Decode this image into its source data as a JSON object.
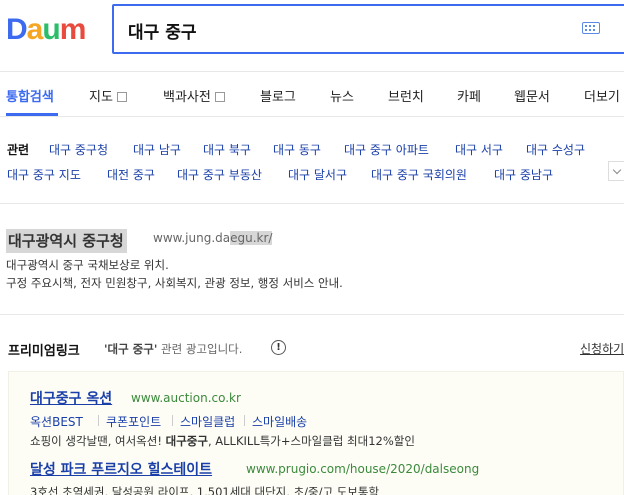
{
  "logo": {
    "letters": [
      "D",
      "a",
      "u",
      "m"
    ],
    "colors": [
      "#3d6bf0",
      "#f5a623",
      "#2bbd6a",
      "#e84a3d"
    ]
  },
  "search": {
    "value": "대구 중구",
    "accent": "#3d6bf0"
  },
  "tabs": [
    {
      "label": "통합검색",
      "active": true
    },
    {
      "label": "지도",
      "checkbox": true
    },
    {
      "label": "백과사전",
      "checkbox": true
    },
    {
      "label": "블로그"
    },
    {
      "label": "뉴스"
    },
    {
      "label": "브런치"
    },
    {
      "label": "카페"
    },
    {
      "label": "웹문서"
    },
    {
      "label": "더보기"
    }
  ],
  "related": {
    "title": "관련",
    "row1": [
      "대구 중구청",
      "대구 남구",
      "대구 북구",
      "대구 동구",
      "대구 중구 아파트",
      "대구 서구",
      "대구 수성구"
    ],
    "row2": [
      "대구 중구 지도",
      "대전 중구",
      "대구 중구 부동산",
      "대구 달서구",
      "대구 중구 국회의원",
      "대구 중남구"
    ]
  },
  "result": {
    "title": "대구광역시 중구청",
    "url_part1": "www.jung.da",
    "url_part2": "egu.kr/",
    "desc_line1": "대구광역시 중구 국채보상로 위치.",
    "desc_line2": "구정 주요시책, 전자 민원창구, 사회복지, 관광 정보, 행정 서비스 안내."
  },
  "premium": {
    "title": "프리미엄링크",
    "query": "'대구 중구'",
    "sub_suffix": " 관련 광고입니다.",
    "info_icon": "!",
    "apply_label": "신청하기",
    "ads": [
      {
        "title": "대구중구 옥션",
        "url": "www.auction.co.kr",
        "sublinks": [
          "옥션BEST",
          "쿠폰포인트",
          "스마일클럽",
          "스마일배송"
        ],
        "desc_pre": "쇼핑이 생각날땐, 여서옥션! ",
        "desc_bold": "대구중구",
        "desc_post": ", ALLKILL특가+스마일클럽 최대12%할인"
      },
      {
        "title": "달성 파크 푸르지오 힐스테이트",
        "url": "www.prugio.com/house/2020/dalseong",
        "desc": "3호선 초역세권, 달성공원 라이프, 1,501세대 대단지, 초/중/고 도보통학"
      }
    ]
  }
}
